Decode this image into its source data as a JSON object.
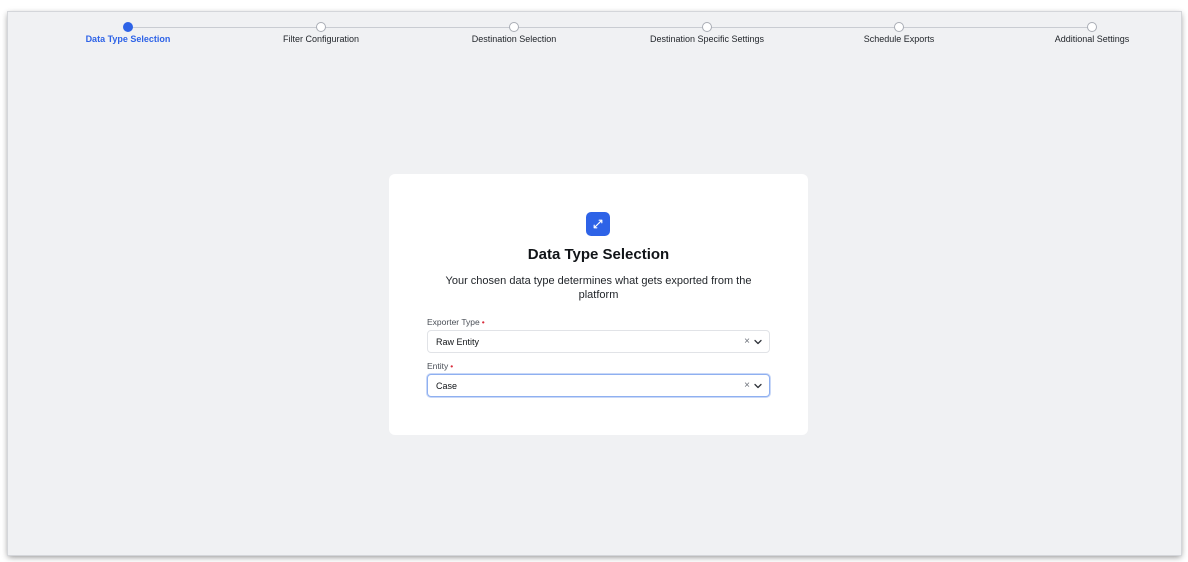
{
  "stepper": {
    "steps": [
      {
        "label": "Data Type Selection",
        "active": true
      },
      {
        "label": "Filter Configuration",
        "active": false
      },
      {
        "label": "Destination Selection",
        "active": false
      },
      {
        "label": "Destination Specific Settings",
        "active": false
      },
      {
        "label": "Schedule Exports",
        "active": false
      },
      {
        "label": "Additional Settings",
        "active": false
      }
    ]
  },
  "card": {
    "icon": "transfer-arrows-icon",
    "title": "Data Type Selection",
    "description": "Your chosen data type determines what gets exported from the platform",
    "fields": [
      {
        "label": "Exporter Type",
        "required_mark": "•",
        "value": "Raw Entity",
        "clear": "×"
      },
      {
        "label": "Entity",
        "required_mark": "•",
        "value": "Case",
        "clear": "×"
      }
    ]
  },
  "colors": {
    "accent": "#2e63e7",
    "required": "#d92d3c",
    "background": "#f0f1f3"
  }
}
